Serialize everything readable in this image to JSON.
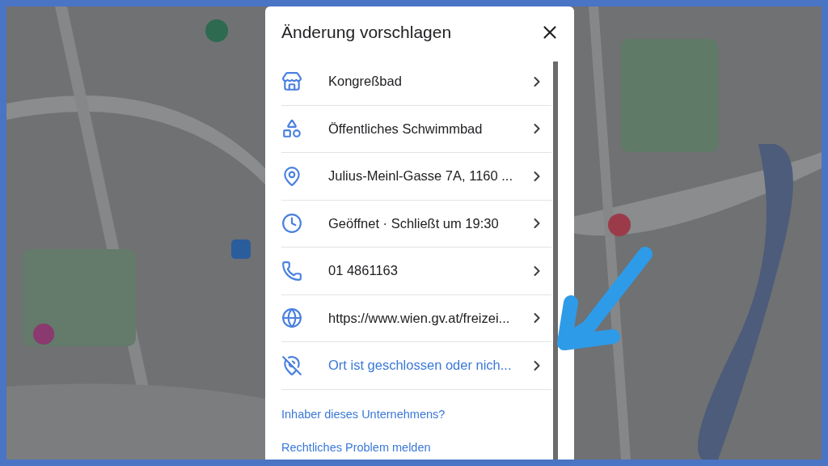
{
  "dialog": {
    "title": "Änderung vorschlagen",
    "rows": [
      {
        "kind": "info",
        "label": "Kongreßbad"
      },
      {
        "kind": "info",
        "label": "Öffentliches Schwimmbad"
      },
      {
        "kind": "info",
        "label": "Julius-Meinl-Gasse 7A, 1160 ..."
      },
      {
        "kind": "info",
        "label": "Geöffnet · Schließt um 19:30"
      },
      {
        "kind": "info",
        "label": "01 4861163"
      },
      {
        "kind": "info",
        "label": "https://www.wien.gv.at/freizei..."
      },
      {
        "kind": "action",
        "label": "Ort ist geschlossen oder nich..."
      }
    ],
    "links": [
      "Inhaber dieses Unternehmens?",
      "Rechtliches Problem melden"
    ]
  }
}
